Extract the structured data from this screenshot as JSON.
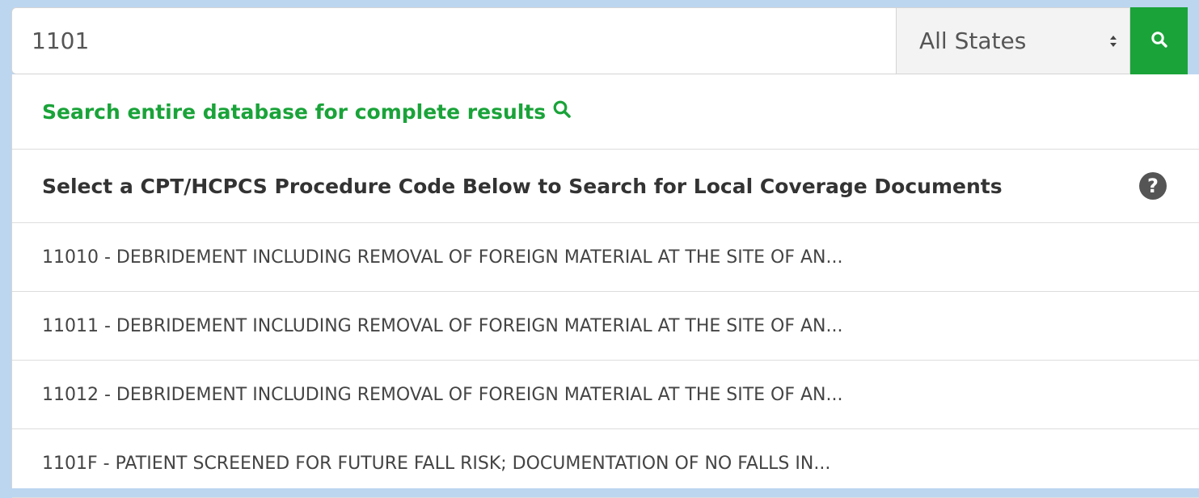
{
  "search": {
    "query": "1101",
    "state_selected": "All States"
  },
  "dropdown": {
    "db_link_label": "Search entire database for complete results",
    "header": "Select a CPT/HCPCS Procedure Code Below to Search for Local Coverage Documents",
    "help_glyph": "?",
    "results": [
      "11010 - DEBRIDEMENT INCLUDING REMOVAL OF FOREIGN MATERIAL AT THE SITE OF AN...",
      "11011 - DEBRIDEMENT INCLUDING REMOVAL OF FOREIGN MATERIAL AT THE SITE OF AN...",
      "11012 - DEBRIDEMENT INCLUDING REMOVAL OF FOREIGN MATERIAL AT THE SITE OF AN...",
      "1101F - PATIENT SCREENED FOR FUTURE FALL RISK; DOCUMENTATION OF NO FALLS IN..."
    ]
  },
  "icons": {
    "search_button": "search-icon",
    "db_link": "search-icon",
    "help": "question-circle-icon",
    "select": "sort-arrows-icon"
  },
  "colors": {
    "accent_green": "#1aa339",
    "page_background": "#bcd6f0",
    "help_icon": "#555555"
  }
}
